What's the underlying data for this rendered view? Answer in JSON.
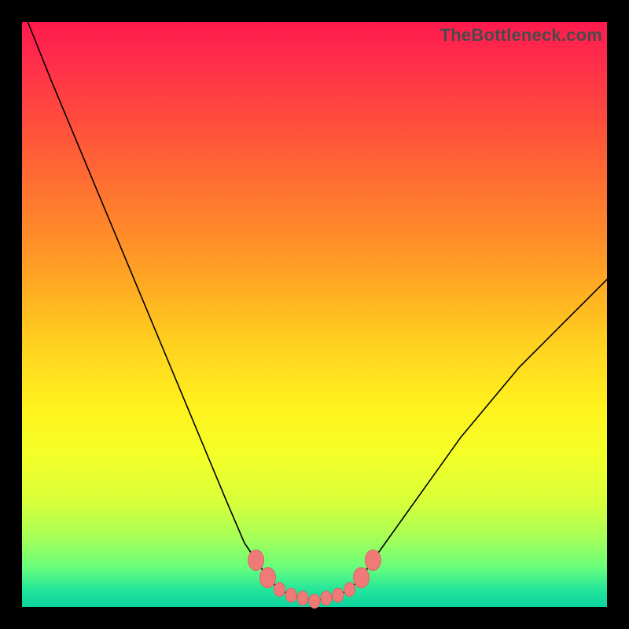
{
  "watermark": "TheBottleneck.com",
  "colors": {
    "frame": "#000000",
    "curve": "#000000",
    "marker": "#f07a78",
    "gradient_top": "#ff1a4d",
    "gradient_bottom": "#0bd39e"
  },
  "chart_data": {
    "type": "line",
    "title": "",
    "xlabel": "",
    "ylabel": "",
    "xlim": [
      0,
      100
    ],
    "ylim": [
      0,
      100
    ],
    "grid": false,
    "legend": false,
    "series": [
      {
        "name": "bottleneck-curve",
        "x": [
          1,
          5,
          10,
          15,
          20,
          25,
          30,
          35,
          38,
          40,
          42,
          44,
          46,
          48,
          50,
          52,
          54,
          56,
          58,
          60,
          65,
          70,
          75,
          80,
          85,
          90,
          95,
          100
        ],
        "y": [
          100,
          90,
          78,
          66,
          54,
          42,
          30,
          18,
          11,
          8,
          5,
          3,
          2,
          1.5,
          1,
          1.5,
          2,
          3,
          5,
          8,
          15,
          22,
          29,
          35,
          41,
          46,
          51,
          56
        ]
      }
    ],
    "markers": {
      "name": "highlight-points",
      "x": [
        40,
        42,
        44,
        46,
        48,
        50,
        52,
        54,
        56,
        58,
        60
      ],
      "y": [
        8,
        5,
        3,
        2,
        1.5,
        1,
        1.5,
        2,
        3,
        5,
        8
      ]
    },
    "notes": "Axis values are estimated from visual position; no tick labels are shown in the source image."
  }
}
